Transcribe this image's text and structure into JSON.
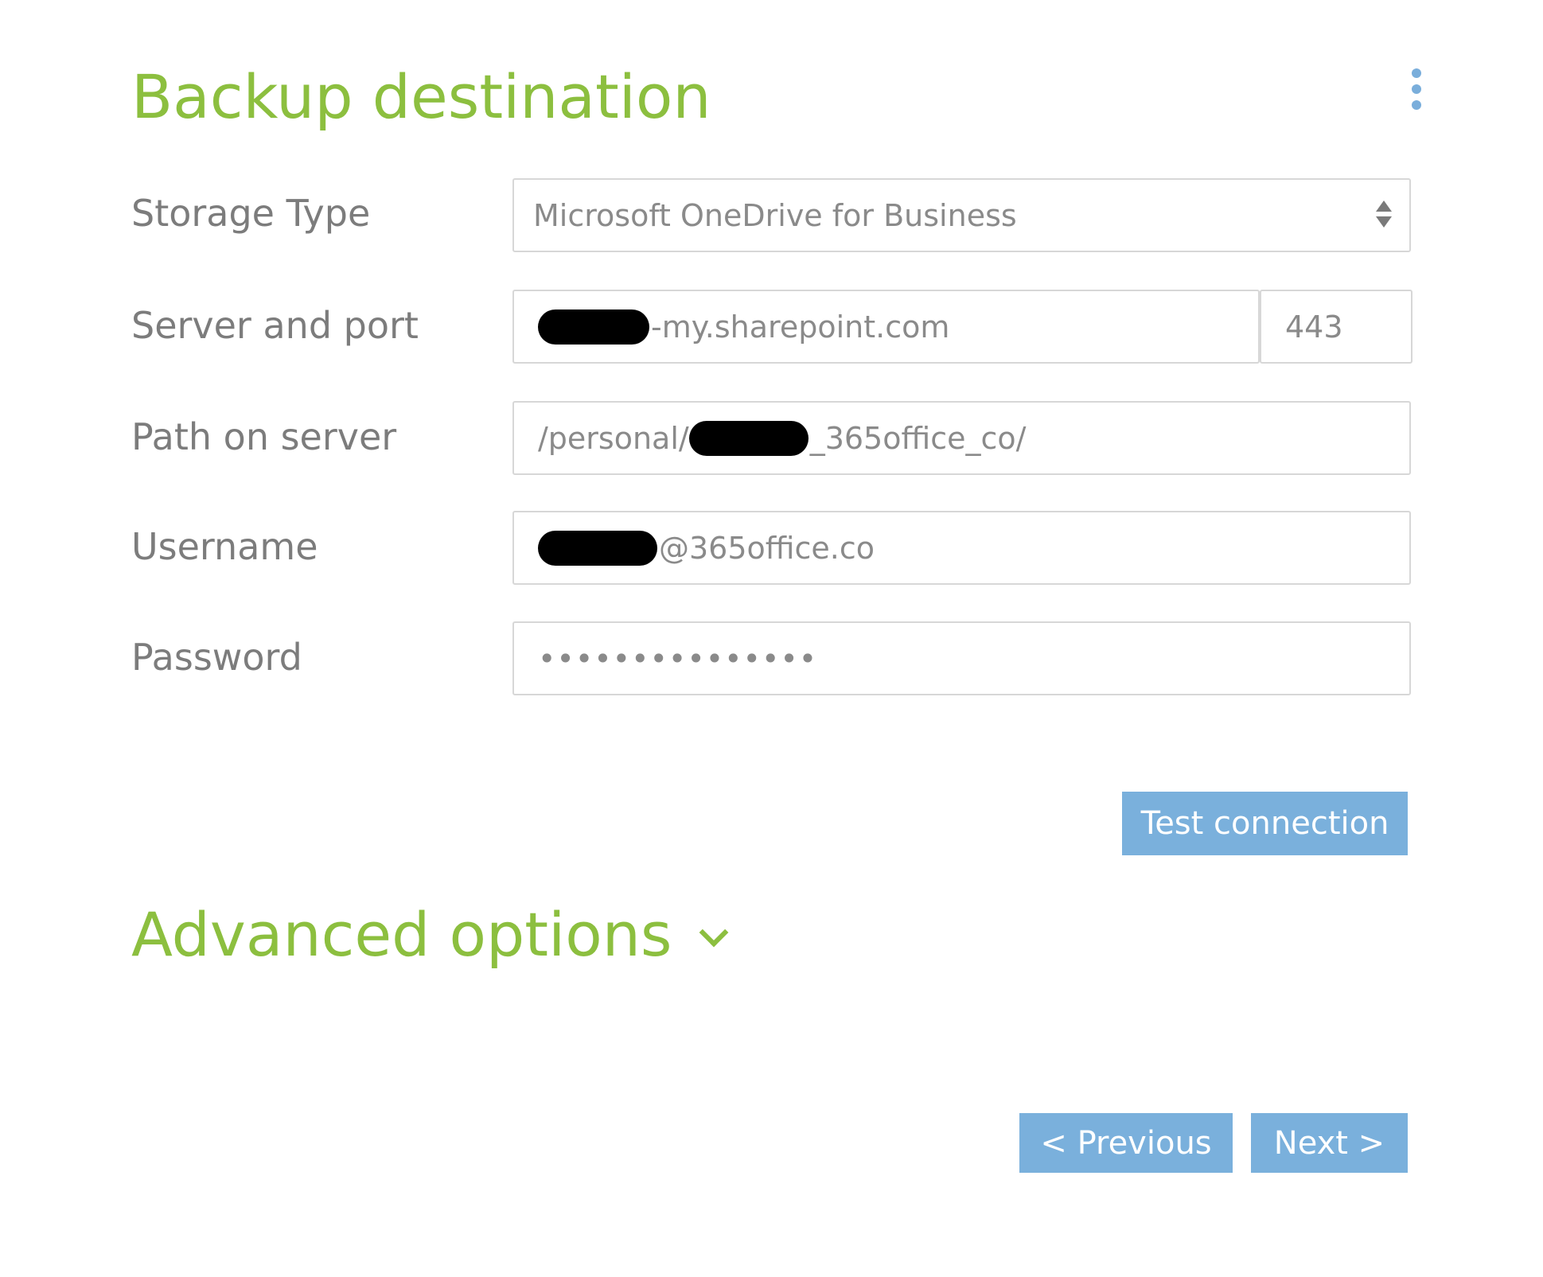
{
  "header": {
    "title": "Backup destination",
    "menu_icon": "kebab-menu-icon"
  },
  "form": {
    "storage_type": {
      "label": "Storage Type",
      "value": "Microsoft OneDrive for Business"
    },
    "server": {
      "label": "Server and port",
      "host_suffix": "-my.sharepoint.com",
      "port": "443"
    },
    "path": {
      "label": "Path on server",
      "prefix": "/personal/",
      "suffix": "_365office_co/"
    },
    "username": {
      "label": "Username",
      "suffix": "@365office.co"
    },
    "password": {
      "label": "Password",
      "masked": "•••••••••••••••"
    }
  },
  "actions": {
    "test_connection": "Test connection",
    "previous": "< Previous",
    "next": "Next >"
  },
  "advanced": {
    "label": "Advanced options",
    "icon": "chevron-down-icon"
  },
  "colors": {
    "accent_green": "#8cbf3f",
    "button_blue": "#7ab0dc"
  }
}
